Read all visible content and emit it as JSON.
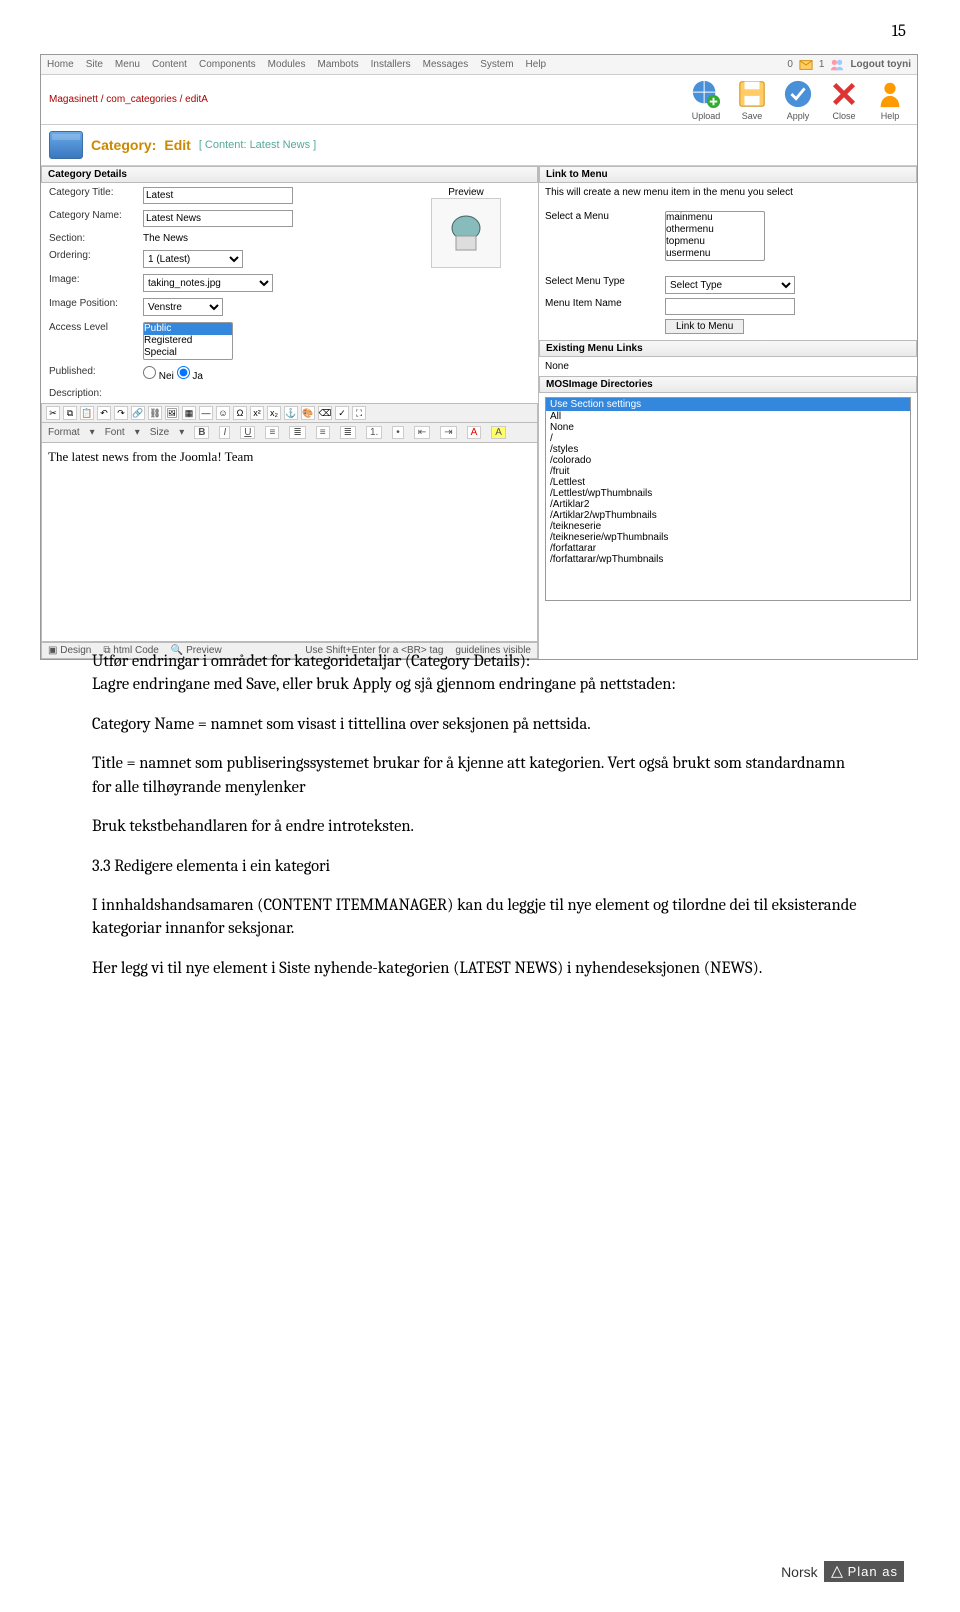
{
  "page_number": "15",
  "screenshot": {
    "menubar": [
      "Home",
      "Site",
      "Menu",
      "Content",
      "Components",
      "Modules",
      "Mambots",
      "Installers",
      "Messages",
      "System",
      "Help"
    ],
    "topright": {
      "count0": "0",
      "count1": "1",
      "logout": "Logout toyni"
    },
    "toolbar": {
      "breadcrumb": "Magasinett / com_categories / editA",
      "buttons": {
        "upload": "Upload",
        "save": "Save",
        "apply": "Apply",
        "close": "Close",
        "help": "Help"
      }
    },
    "titlebar": {
      "title": "Category:",
      "action": "Edit",
      "sub": "[ Content: Latest News ]"
    },
    "left": {
      "header": "Category Details",
      "fields": {
        "cat_title_lbl": "Category Title:",
        "cat_title_val": "Latest",
        "cat_name_lbl": "Category Name:",
        "cat_name_val": "Latest News",
        "section_lbl": "Section:",
        "section_val": "The News",
        "ordering_lbl": "Ordering:",
        "ordering_val": "1 (Latest)",
        "image_lbl": "Image:",
        "image_val": "taking_notes.jpg",
        "imgpos_lbl": "Image Position:",
        "imgpos_val": "Venstre",
        "access_lbl": "Access Level",
        "access_opts": [
          "Public",
          "Registered",
          "Special"
        ],
        "published_lbl": "Published:",
        "published_no": "Nei",
        "published_yes": "Ja",
        "desc_lbl": "Description:",
        "preview_lbl": "Preview"
      },
      "editor": {
        "format_dd": "Format",
        "font_dd": "Font",
        "size_dd": "Size",
        "body": "The latest news from the Joomla! Team",
        "footer": {
          "design": "Design",
          "html": "html Code",
          "preview": "Preview",
          "hint": "Use Shift+Enter for a <BR> tag",
          "guidelines": "guidelines visible"
        }
      }
    },
    "right": {
      "link_hdr": "Link to Menu",
      "link_note": "This will create a new menu item in the menu you select",
      "select_menu_lbl": "Select a Menu",
      "menus": [
        "mainmenu",
        "othermenu",
        "topmenu",
        "usermenu"
      ],
      "menu_type_lbl": "Select Menu Type",
      "menu_type_val": "Select Type",
      "item_name_lbl": "Menu Item Name",
      "link_btn": "Link to Menu",
      "existing_hdr": "Existing Menu Links",
      "existing_none": "None",
      "mos_hdr": "MOSImage Directories",
      "mos_selected": "Use Section settings",
      "mos_dirs": [
        "All",
        "None",
        "/",
        "/styles",
        "/colorado",
        "/fruit",
        "/Lettlest",
        "/Lettlest/wpThumbnails",
        "/Artiklar2",
        "/Artiklar2/wpThumbnails",
        "/teikneserie",
        "/teikneserie/wpThumbnails",
        "/forfattarar",
        "/forfattarar/wpThumbnails"
      ]
    }
  },
  "doc": {
    "p1": "Utfør endringar i området for kategoridetaljar (Category Details):",
    "p2": "Lagre endringane med Save, eller bruk Apply og sjå gjennom endringane på nettstaden:",
    "p3": "Category Name = namnet som visast i tittellina over seksjonen på nettsida.",
    "p4": "Title = namnet som publiseringssystemet brukar for å kjenne att kategorien. Vert også brukt som standardnamn for alle tilhøyrande menylenker",
    "p5": "Bruk tekstbehandlaren for å endre introteksten.",
    "h": "3.3 Redigere elementa i ein kategori",
    "p6": "I innhaldshandsamaren (CONTENT ITEMMANAGER) kan du leggje til nye element og tilordne dei til eksisterande kategoriar innanfor seksjonar.",
    "p7": "Her legg vi til nye element i Siste nyhende-kategorien (LATEST NEWS) i nyhendeseksjonen (NEWS)."
  },
  "footer": {
    "brand": "Norsk",
    "sub": "Plan as"
  }
}
